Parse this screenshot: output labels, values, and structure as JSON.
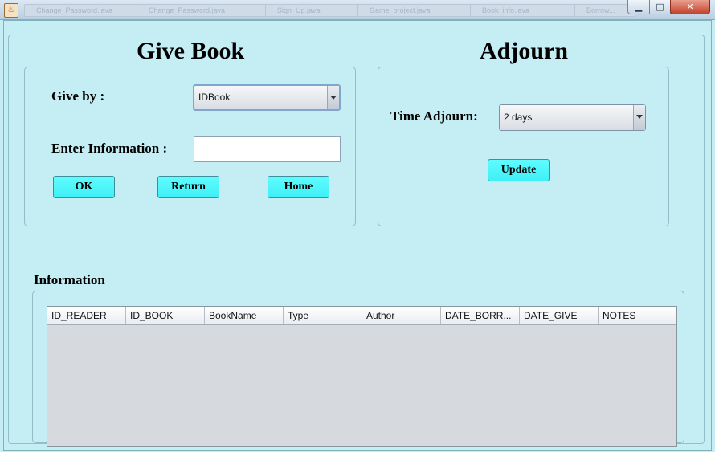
{
  "window": {
    "background_tabs": [
      "Change_Password.java",
      "Change_Password.java",
      "Sign_Up.java",
      "Game_project.java",
      "Book_info.java",
      "Borrow..."
    ],
    "minimize_glyph": "▁",
    "maximize_glyph": "□",
    "close_glyph": "✕",
    "app_icon_glyph": "♨"
  },
  "give_book": {
    "title": "Give Book",
    "give_by_label": "Give by :",
    "give_by_value": "IDBook",
    "enter_info_label": "Enter Information :",
    "enter_info_value": "",
    "ok_label": "OK",
    "return_label": "Return",
    "home_label": "Home"
  },
  "adjourn": {
    "title": "Adjourn",
    "time_label": "Time Adjourn:",
    "time_value": "2 days",
    "update_label": "Update"
  },
  "information": {
    "title": "Information",
    "columns": [
      "ID_READER",
      "ID_BOOK",
      "BookName",
      "Type",
      "Author",
      "DATE_BORR...",
      "DATE_GIVE",
      "NOTES"
    ]
  },
  "colors": {
    "background": "#c4eef4",
    "button": "#4ff6fb",
    "table_body": "#d6d9de"
  }
}
